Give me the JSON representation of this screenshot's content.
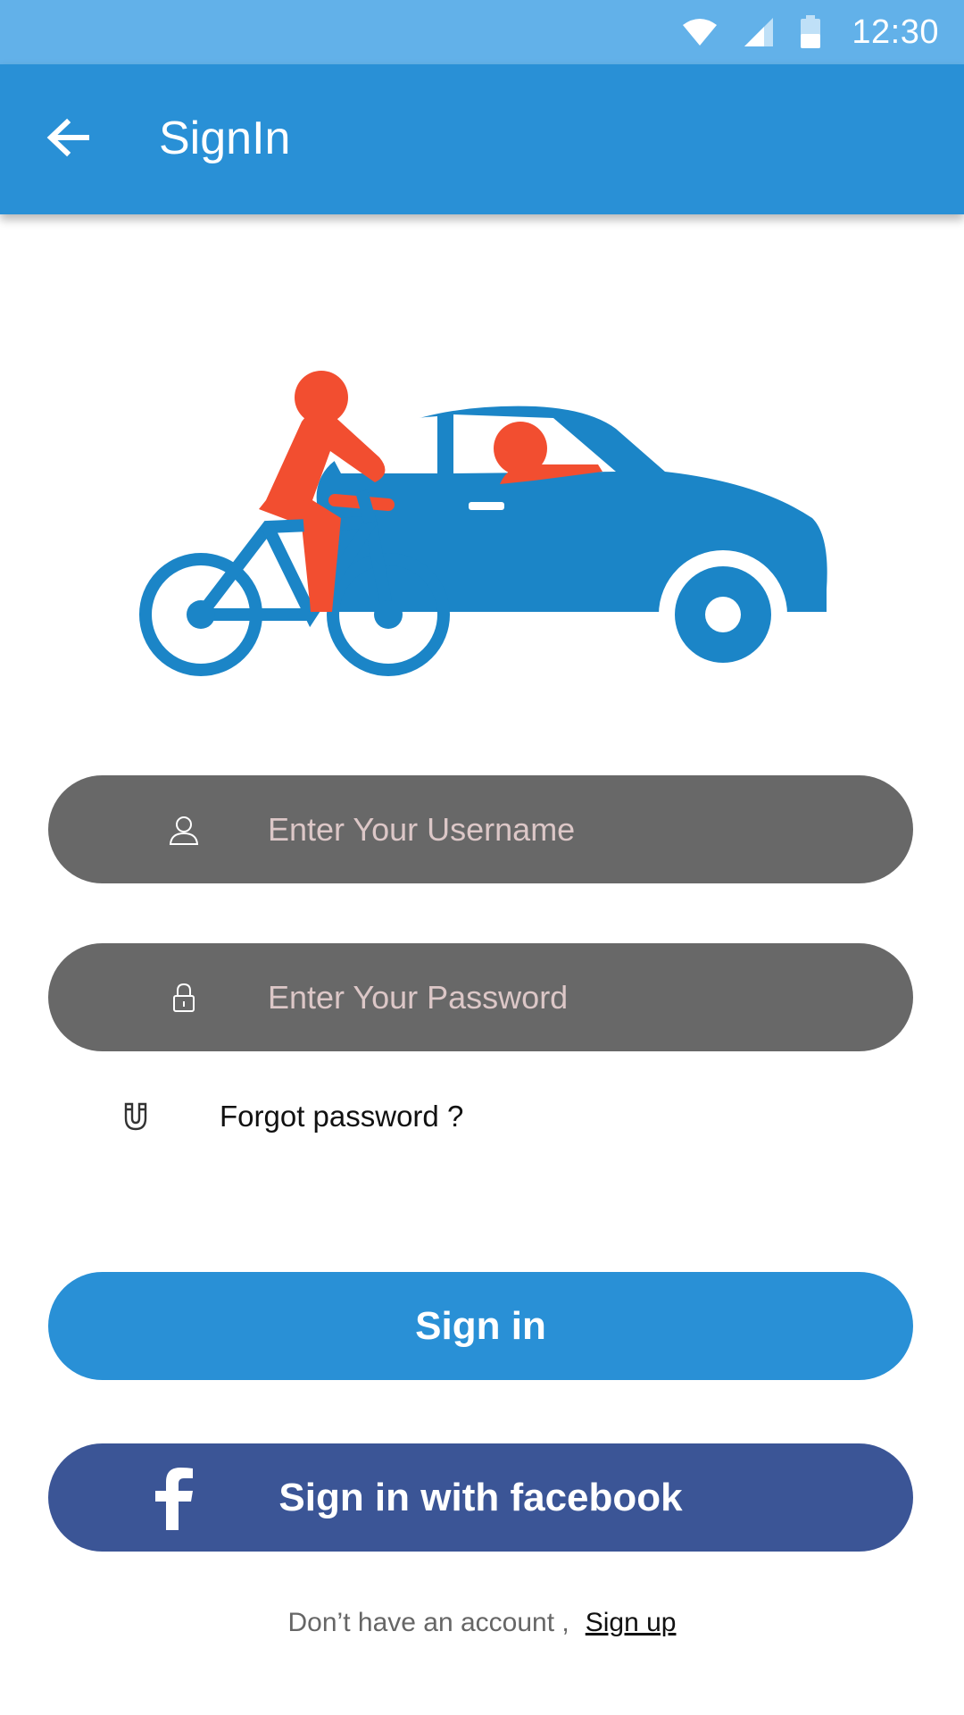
{
  "status_bar": {
    "time": "12:30",
    "icons": [
      "wifi-icon",
      "cell-signal-icon",
      "battery-icon"
    ]
  },
  "app_bar": {
    "title": "SignIn",
    "back_icon": "arrow-left-icon"
  },
  "hero": {
    "description_icon": "bicycle-and-car-illustration"
  },
  "form": {
    "username": {
      "icon": "user-icon",
      "placeholder": "Enter Your Username",
      "value": ""
    },
    "password": {
      "icon": "lock-icon",
      "placeholder": "Enter Your Password",
      "value": ""
    },
    "forgot": {
      "icon": "magnet-icon",
      "label": "Forgot password ?"
    }
  },
  "buttons": {
    "signin_label": "Sign in",
    "facebook_label": "Sign in with facebook",
    "facebook_icon": "facebook-icon"
  },
  "footer": {
    "prompt": "Don’t have an account ,",
    "signup_label": "Sign up"
  },
  "colors": {
    "status_bar": "#62b1e9",
    "app_bar": "#2990d6",
    "primary_button": "#2990d6",
    "facebook_button": "#3b5596",
    "input_background": "#686868",
    "illustration_blue": "#1b85c7",
    "illustration_orange": "#f24e30"
  }
}
